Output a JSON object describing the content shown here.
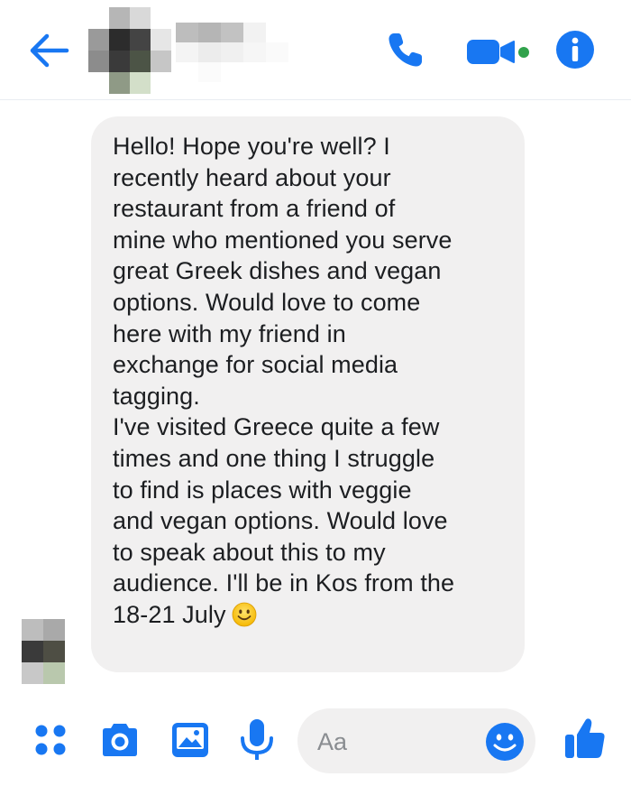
{
  "header": {
    "contact_name": "",
    "icons": [
      "back-arrow-icon",
      "phone-icon",
      "video-camera-icon",
      "info-icon"
    ],
    "accent_color": "#1877f2",
    "active_dot_color": "#31a24c"
  },
  "message": {
    "paragraph1": "Hello! Hope you're well? I\nrecently heard about your\nrestaurant from a friend of\nmine who mentioned you serve\ngreat Greek dishes and vegan\noptions. Would love to come\nhere with my friend in\nexchange for social media\ntagging.",
    "paragraph2": "I've visited Greece quite a few\ntimes and one thing I struggle\nto find is places with veggie\nand vegan options. Would love\nto speak about this to my\naudience. I'll be in Kos from the\n18-21 July",
    "emoji": "slightly-smiling-face",
    "bubble_color": "#f1f0f0"
  },
  "composer": {
    "placeholder": "Aa",
    "icons": [
      "menu-dots-icon",
      "camera-icon",
      "gallery-icon",
      "microphone-icon",
      "emoji-icon",
      "thumbs-up-icon"
    ]
  }
}
